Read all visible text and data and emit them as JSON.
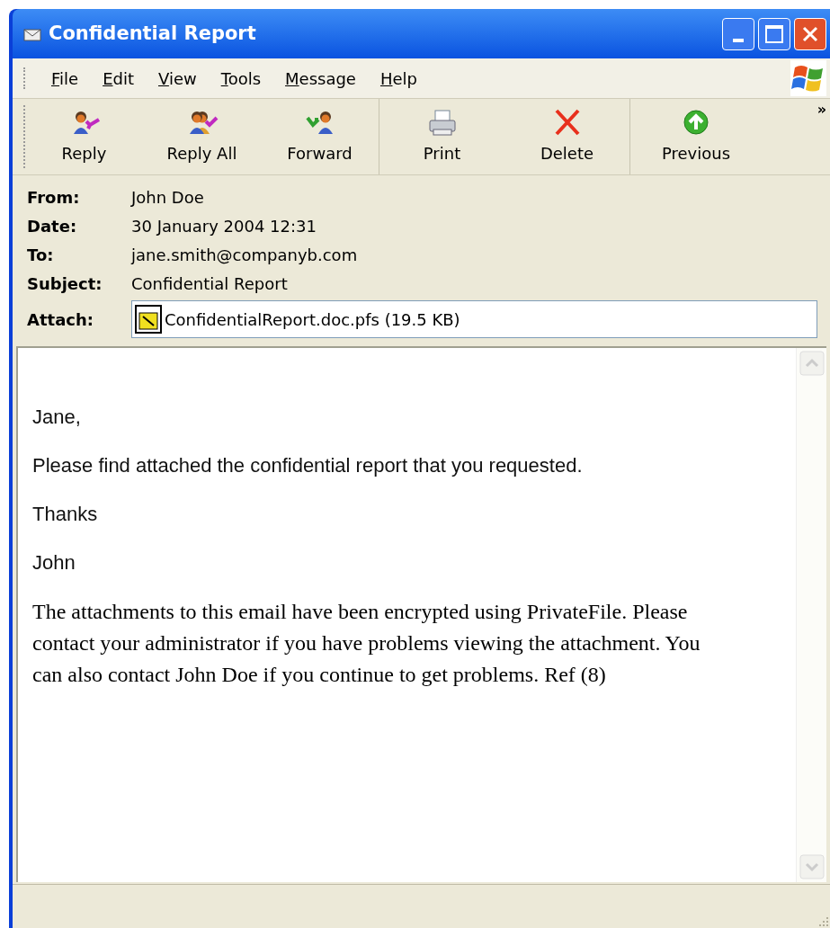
{
  "window": {
    "title": "Confidential Report"
  },
  "menu": [
    "File",
    "Edit",
    "View",
    "Tools",
    "Message",
    "Help"
  ],
  "toolbar": {
    "groups": [
      [
        {
          "label": "Reply",
          "kind": "reply"
        },
        {
          "label": "Reply All",
          "kind": "reply_all"
        },
        {
          "label": "Forward",
          "kind": "forward"
        }
      ],
      [
        {
          "label": "Print",
          "kind": "print"
        },
        {
          "label": "Delete",
          "kind": "delete"
        }
      ],
      [
        {
          "label": "Previous",
          "kind": "previous"
        }
      ]
    ],
    "overflow": "»"
  },
  "headers": [
    {
      "label": "From:",
      "value": "John Doe"
    },
    {
      "label": "Date:",
      "value": "30 January 2004 12:31"
    },
    {
      "label": "To:",
      "value": "jane.smith@companyb.com"
    },
    {
      "label": "Subject:",
      "value": "Confidential Report"
    }
  ],
  "attachment": {
    "label": "Attach:",
    "file": "ConfidentialReport.doc.pfs (19.5 KB)"
  },
  "body": [
    {
      "kind": "message",
      "text": "Jane,"
    },
    {
      "kind": "message",
      "text": "Please find attached the confidential report that you requested."
    },
    {
      "kind": "message",
      "text": "Thanks"
    },
    {
      "kind": "message",
      "text": "John"
    },
    {
      "kind": "notice",
      "text": "The attachments to this email have been encrypted using PrivateFile. Please contact your administrator if you have problems viewing the attachment. You can also contact John Doe if you continue to get problems. Ref (8)"
    }
  ]
}
